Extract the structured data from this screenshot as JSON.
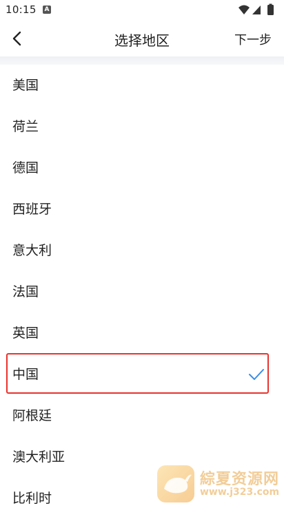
{
  "status_bar": {
    "time": "10:15",
    "notification_badge": "A"
  },
  "header": {
    "title": "选择地区",
    "next_label": "下一步"
  },
  "regions": [
    {
      "label": "美国"
    },
    {
      "label": "荷兰"
    },
    {
      "label": "德国"
    },
    {
      "label": "西班牙"
    },
    {
      "label": "意大利"
    },
    {
      "label": "法国"
    },
    {
      "label": "英国"
    },
    {
      "label": "中国",
      "selected": true
    },
    {
      "label": "阿根廷"
    },
    {
      "label": "澳大利亚"
    },
    {
      "label": "比利时"
    }
  ],
  "watermark": {
    "name": "綜夏资源网",
    "url": "www.j323.com"
  },
  "colors": {
    "accent_check": "#3a8ee6",
    "highlight_border": "#e8322c"
  }
}
